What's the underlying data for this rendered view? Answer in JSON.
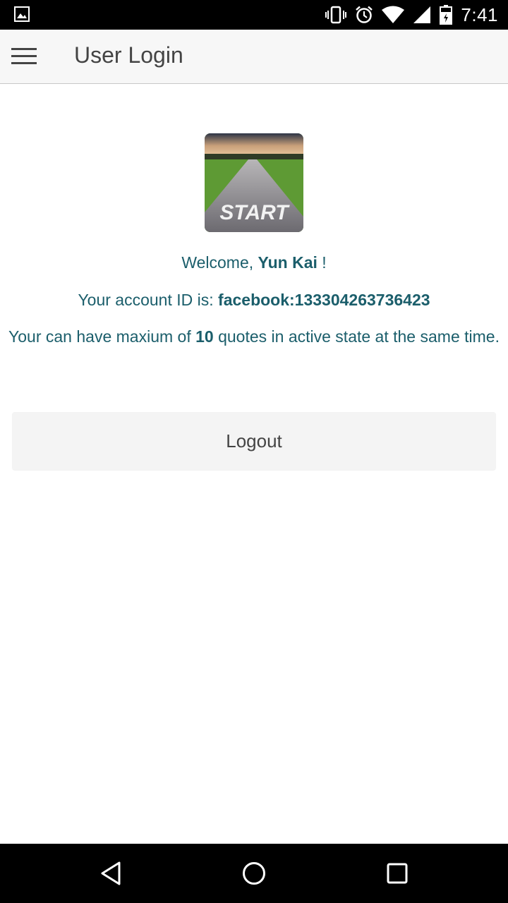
{
  "status_bar": {
    "time": "7:41",
    "icons": [
      "image-notification-icon",
      "vibrate-icon",
      "alarm-icon",
      "wifi-icon",
      "cell-signal-icon",
      "battery-icon"
    ]
  },
  "app_bar": {
    "title": "User Login",
    "menu_icon": "hamburger-menu-icon"
  },
  "profile": {
    "avatar_caption": "START",
    "welcome_prefix": "Welcome, ",
    "user_name": "Yun Kai",
    "welcome_suffix": " !",
    "account_prefix": "Your account ID is: ",
    "account_id": "facebook:133304263736423",
    "quota_prefix": "Your can have maxium of ",
    "quota_count": "10",
    "quota_suffix": " quotes in active state at the same time."
  },
  "actions": {
    "logout_label": "Logout"
  },
  "colors": {
    "text_accent": "#1b5e6b",
    "app_bar_bg": "#f7f7f7",
    "button_bg": "#f4f4f4"
  },
  "nav_bar": {
    "icons": [
      "back-icon",
      "home-icon",
      "recent-apps-icon"
    ]
  }
}
